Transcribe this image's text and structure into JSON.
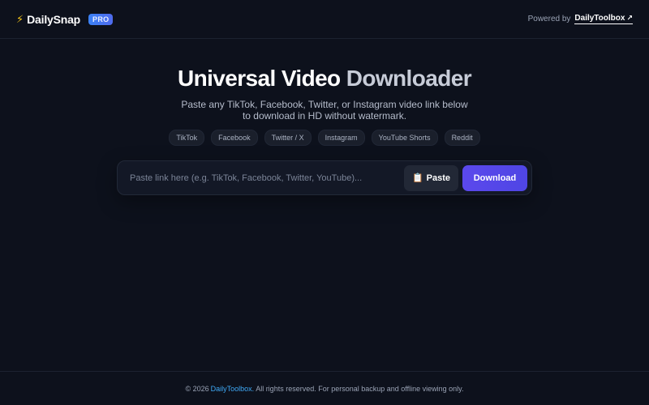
{
  "header": {
    "brand_name": "DailySnap",
    "badge": "PRO",
    "powered_by": "Powered by",
    "powered_link": "DailyToolbox",
    "bolt_icon": "lightning-bolt-icon",
    "arrow_icon": "external-arrow-icon"
  },
  "hero": {
    "title_part1": "Universal Video",
    "title_part2": "Downloader",
    "subtitle": "Paste any TikTok, Facebook, Twitter, or Instagram video link below to download in HD without watermark.",
    "platforms": [
      "TikTok",
      "Facebook",
      "Twitter / X",
      "Instagram",
      "YouTube Shorts",
      "Reddit"
    ]
  },
  "search": {
    "value": "",
    "placeholder": "Paste link here (e.g. TikTok, Facebook, Twitter, YouTube)...",
    "paste_label": "Paste",
    "paste_icon": "clipboard-icon",
    "download_label": "Download"
  },
  "footer": {
    "prefix": "© 2026",
    "link": "DailyToolbox.",
    "suffix": "All rights reserved. For personal backup and offline viewing only."
  },
  "colors": {
    "background": "#0d111c",
    "accent": "#5145e5",
    "badge": "#3b82f6",
    "link": "#3fa9f5",
    "bolt": "#f5c518"
  }
}
